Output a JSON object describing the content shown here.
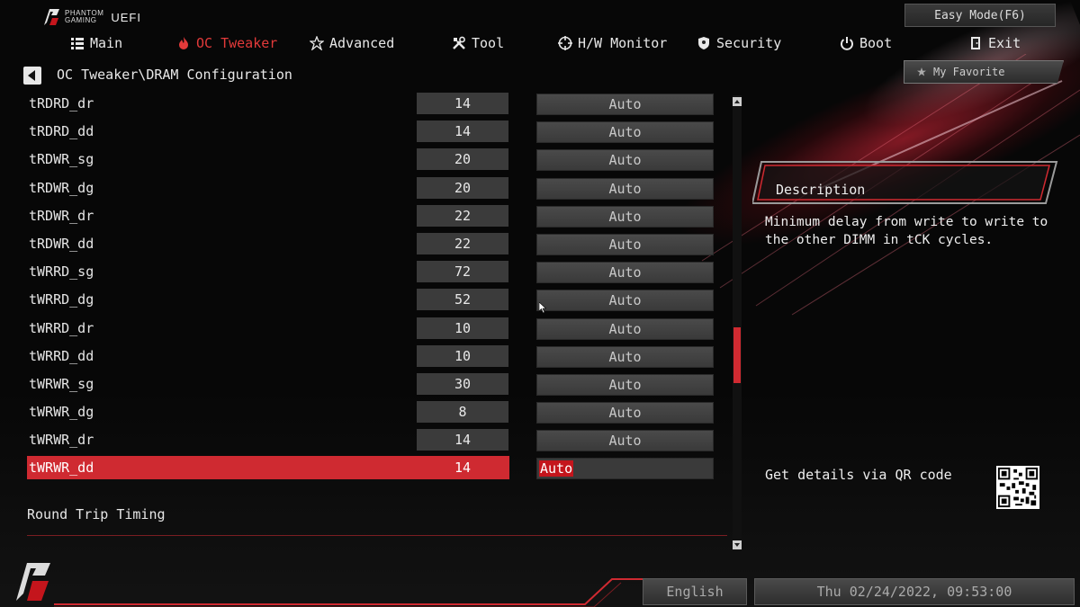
{
  "header": {
    "logo_small_line1": "PHANTOM",
    "logo_small_line2": "GAMING",
    "logo_uefi": "UEFI",
    "easy_mode_label": "Easy Mode(F6)"
  },
  "nav": {
    "items": [
      {
        "label": "Main",
        "icon": "list-icon"
      },
      {
        "label": "OC Tweaker",
        "icon": "flame-icon",
        "active": true
      },
      {
        "label": "Advanced",
        "icon": "star-icon"
      },
      {
        "label": "Tool",
        "icon": "tools-icon"
      },
      {
        "label": "H/W Monitor",
        "icon": "crosshair-icon"
      },
      {
        "label": "Security",
        "icon": "shield-icon"
      },
      {
        "label": "Boot",
        "icon": "power-icon"
      },
      {
        "label": "Exit",
        "icon": "door-icon"
      }
    ]
  },
  "breadcrumb": "OC Tweaker\\DRAM Configuration",
  "favorite_label": "My Favorite",
  "rows": [
    {
      "label": "tRDRD_dr",
      "value": "14",
      "setting": "Auto"
    },
    {
      "label": "tRDRD_dd",
      "value": "14",
      "setting": "Auto"
    },
    {
      "label": "tRDWR_sg",
      "value": "20",
      "setting": "Auto"
    },
    {
      "label": "tRDWR_dg",
      "value": "20",
      "setting": "Auto"
    },
    {
      "label": "tRDWR_dr",
      "value": "22",
      "setting": "Auto"
    },
    {
      "label": "tRDWR_dd",
      "value": "22",
      "setting": "Auto"
    },
    {
      "label": "tWRRD_sg",
      "value": "72",
      "setting": "Auto"
    },
    {
      "label": "tWRRD_dg",
      "value": "52",
      "setting": "Auto"
    },
    {
      "label": "tWRRD_dr",
      "value": "10",
      "setting": "Auto"
    },
    {
      "label": "tWRRD_dd",
      "value": "10",
      "setting": "Auto"
    },
    {
      "label": "tWRWR_sg",
      "value": "30",
      "setting": "Auto"
    },
    {
      "label": "tWRWR_dg",
      "value": "8",
      "setting": "Auto"
    },
    {
      "label": "tWRWR_dr",
      "value": "14",
      "setting": "Auto"
    },
    {
      "label": "tWRWR_dd",
      "value": "14",
      "setting": "Auto",
      "selected": true
    }
  ],
  "section_label": "Round Trip Timing",
  "description": {
    "title": "Description",
    "text": "Minimum delay from write to write to the other DIMM in tCK cycles."
  },
  "qr_label": "Get details via QR code",
  "footer": {
    "language": "English",
    "datetime": "Thu 02/24/2022, 09:53:00"
  },
  "colors": {
    "accent": "#cf2a31",
    "active_nav": "#e33a3a"
  }
}
